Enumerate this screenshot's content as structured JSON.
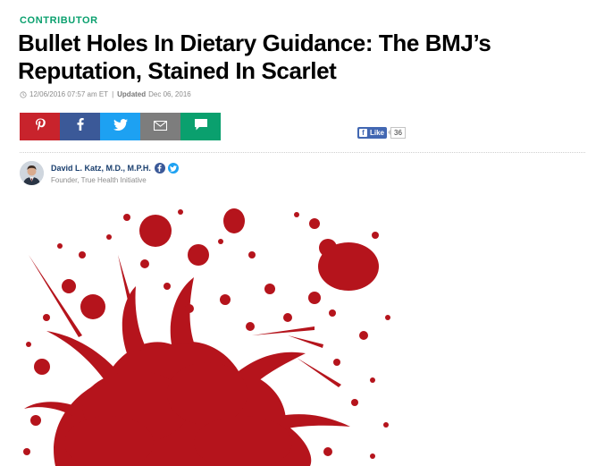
{
  "article": {
    "section_label": "CONTRIBUTOR",
    "headline": "Bullet Holes In Dietary Guidance: The BMJ’s Reputation, Stained In Scarlet",
    "timestamp": {
      "published": "12/06/2016 07:57 am ET",
      "separator": "|",
      "updated_label": "Updated",
      "updated_date": "Dec 06, 2016"
    }
  },
  "share_bar": {
    "buttons": [
      {
        "name": "pinterest",
        "icon": "pinterest-icon",
        "color": "#c8232c"
      },
      {
        "name": "facebook",
        "icon": "facebook-icon",
        "color": "#3b5998"
      },
      {
        "name": "twitter",
        "icon": "twitter-icon",
        "color": "#1da1f2"
      },
      {
        "name": "email",
        "icon": "envelope-icon",
        "color": "#7d7d7d"
      },
      {
        "name": "comment",
        "icon": "comment-icon",
        "color": "#0aa06e"
      }
    ],
    "fb_like": {
      "label": "Like",
      "count": "36"
    }
  },
  "author": {
    "name": "David L. Katz, M.D., M.P.H.",
    "title": "Founder, True Health Initiative",
    "social_icons": [
      "facebook-icon",
      "twitter-icon"
    ]
  },
  "hero_image": {
    "content": "red paint splatter on white background",
    "color": "#b5141c"
  },
  "colors": {
    "accent_green": "#0aa06e",
    "author_name": "#1a3f6e",
    "meta_gray": "#8c8c8c"
  }
}
